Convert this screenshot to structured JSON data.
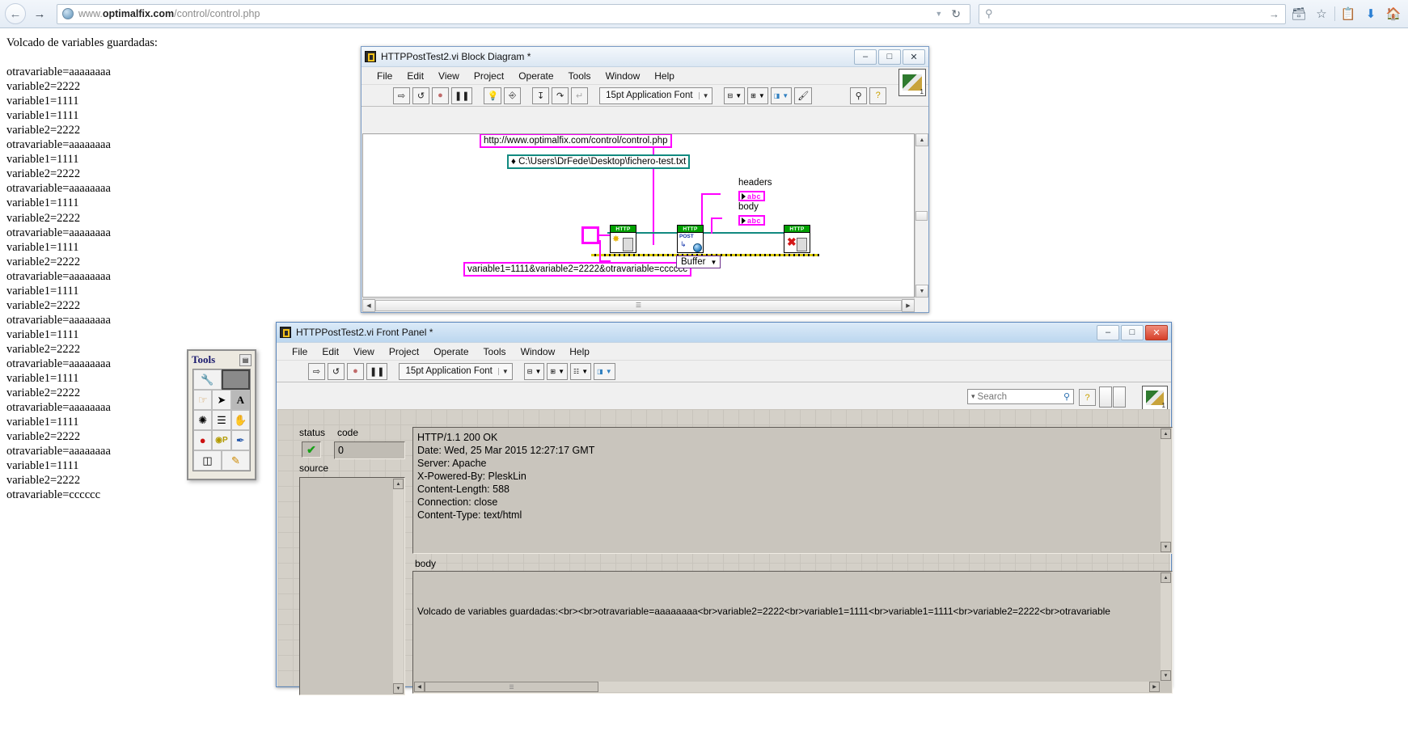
{
  "browser": {
    "back_icon": "back-arrow-icon",
    "forward_icon": "forward-arrow-icon",
    "url_prefix": "www.",
    "url_domain": "optimalfix.com",
    "url_path": "/control/control.php",
    "url_full": "www.optimalfix.com/control/control.php",
    "dropdown_icon": "chevron-down-icon",
    "reload_icon": "reload-icon",
    "search_placeholder": "",
    "search_icon": "search-icon",
    "go_icon": "arrow-right-icon",
    "toolbar_icons": [
      "extension-icon",
      "bookmark-star-icon",
      "reading-list-icon",
      "downloads-icon",
      "home-icon"
    ]
  },
  "page": {
    "heading": "Volcado de variables guardadas:",
    "lines": [
      "otravariable=aaaaaaaa",
      "variable2=2222",
      "variable1=1111",
      "variable1=1111",
      "variable2=2222",
      "otravariable=aaaaaaaa",
      "variable1=1111",
      "variable2=2222",
      "otravariable=aaaaaaaa",
      "variable1=1111",
      "variable2=2222",
      "otravariable=aaaaaaaa",
      "variable1=1111",
      "variable2=2222",
      "otravariable=aaaaaaaa",
      "variable1=1111",
      "variable2=2222",
      "otravariable=aaaaaaaa",
      "variable1=1111",
      "variable2=2222",
      "otravariable=aaaaaaaa",
      "variable1=1111",
      "variable2=2222",
      "otravariable=aaaaaaaa",
      "variable1=1111",
      "variable2=2222",
      "otravariable=aaaaaaaa",
      "variable1=1111",
      "variable2=2222",
      "otravariable=cccccc"
    ]
  },
  "block_diagram": {
    "title": "HTTPPostTest2.vi Block Diagram *",
    "menu": [
      "File",
      "Edit",
      "View",
      "Project",
      "Operate",
      "Tools",
      "Window",
      "Help"
    ],
    "font_selector": "15pt Application Font",
    "minimize_label": "–",
    "maximize_label": "□",
    "close_label": "✕",
    "corner_number": "1",
    "run_icon": "run-arrow-icon",
    "run_continuous_icon": "run-continuous-icon",
    "abort_icon": "abort-stop-icon",
    "pause_icon": "pause-icon",
    "highlight_icon": "highlight-execution-bulb-icon",
    "step_into_icon": "step-into-icon",
    "step_over_icon": "step-over-icon",
    "step_out_icon": "step-out-icon",
    "align_icon": "align-objects-icon",
    "distribute_icon": "distribute-objects-icon",
    "reorder_icon": "reorder-icon",
    "cleanup_icon": "cleanup-diagram-icon",
    "search_icon": "search-icon",
    "help_icon": "context-help-icon",
    "nodes": {
      "url_string": "http://www.optimalfix.com/control/control.php",
      "file_path": "C:\\Users\\DrFede\\Desktop\\fichero-test.txt",
      "post_body": "variable1=1111&variable2=2222&otravariable=cccccc",
      "headers_label": "headers",
      "body_label": "body",
      "buffer_label": "Buffer",
      "http_open": "HTTP",
      "http_post": "HTTP",
      "http_close": "HTTP",
      "post_sub": "POST",
      "indicator_text": "abc"
    }
  },
  "front_panel": {
    "title": "HTTPPostTest2.vi Front Panel *",
    "menu": [
      "File",
      "Edit",
      "View",
      "Project",
      "Operate",
      "Tools",
      "Window",
      "Help"
    ],
    "font_selector": "15pt Application Font",
    "minimize_label": "–",
    "maximize_label": "□",
    "close_label": "✕",
    "corner_number": "1",
    "search_placeholder": "Search",
    "search_icon": "search-icon",
    "help_icon": "context-help-icon",
    "controls": {
      "status_label": "status",
      "status_value": "✔",
      "code_label": "code",
      "code_value": "0",
      "source_label": "source",
      "source_value": "",
      "headers_text": "HTTP/1.1 200 OK\nDate: Wed, 25 Mar 2015 12:27:17 GMT\nServer: Apache\nX-Powered-By: PleskLin\nContent-Length: 588\nConnection: close\nContent-Type: text/html",
      "body_label": "body",
      "body_text": "Volcado de variables guardadas:<br><br>otravariable=aaaaaaaa<br>variable2=2222<br>variable1=1111<br>variable1=1111<br>variable2=2222<br>otravariable"
    }
  },
  "tools_palette": {
    "title": "Tools",
    "close_icon": "close-icon",
    "items": [
      {
        "name": "automatic-tool-selection",
        "glyph": "⚒"
      },
      {
        "name": "tool-indicator-bar",
        "glyph": ""
      },
      {
        "name": "operate-value-hand-tool",
        "glyph": "☞"
      },
      {
        "name": "position-size-select-tool",
        "glyph": "➤"
      },
      {
        "name": "edit-text-tool",
        "glyph": "A"
      },
      {
        "name": "connect-wire-tool",
        "glyph": "⁂"
      },
      {
        "name": "object-shortcut-menu-tool",
        "glyph": "☰"
      },
      {
        "name": "scroll-window-tool",
        "glyph": "✋"
      },
      {
        "name": "set-clear-breakpoint-tool",
        "glyph": "●"
      },
      {
        "name": "probe-data-tool",
        "glyph": "P"
      },
      {
        "name": "get-color-tool",
        "glyph": "✒"
      },
      {
        "name": "set-color-foreground-background",
        "glyph": "▣"
      },
      {
        "name": "paint-brush-tool",
        "glyph": "✎"
      }
    ]
  }
}
